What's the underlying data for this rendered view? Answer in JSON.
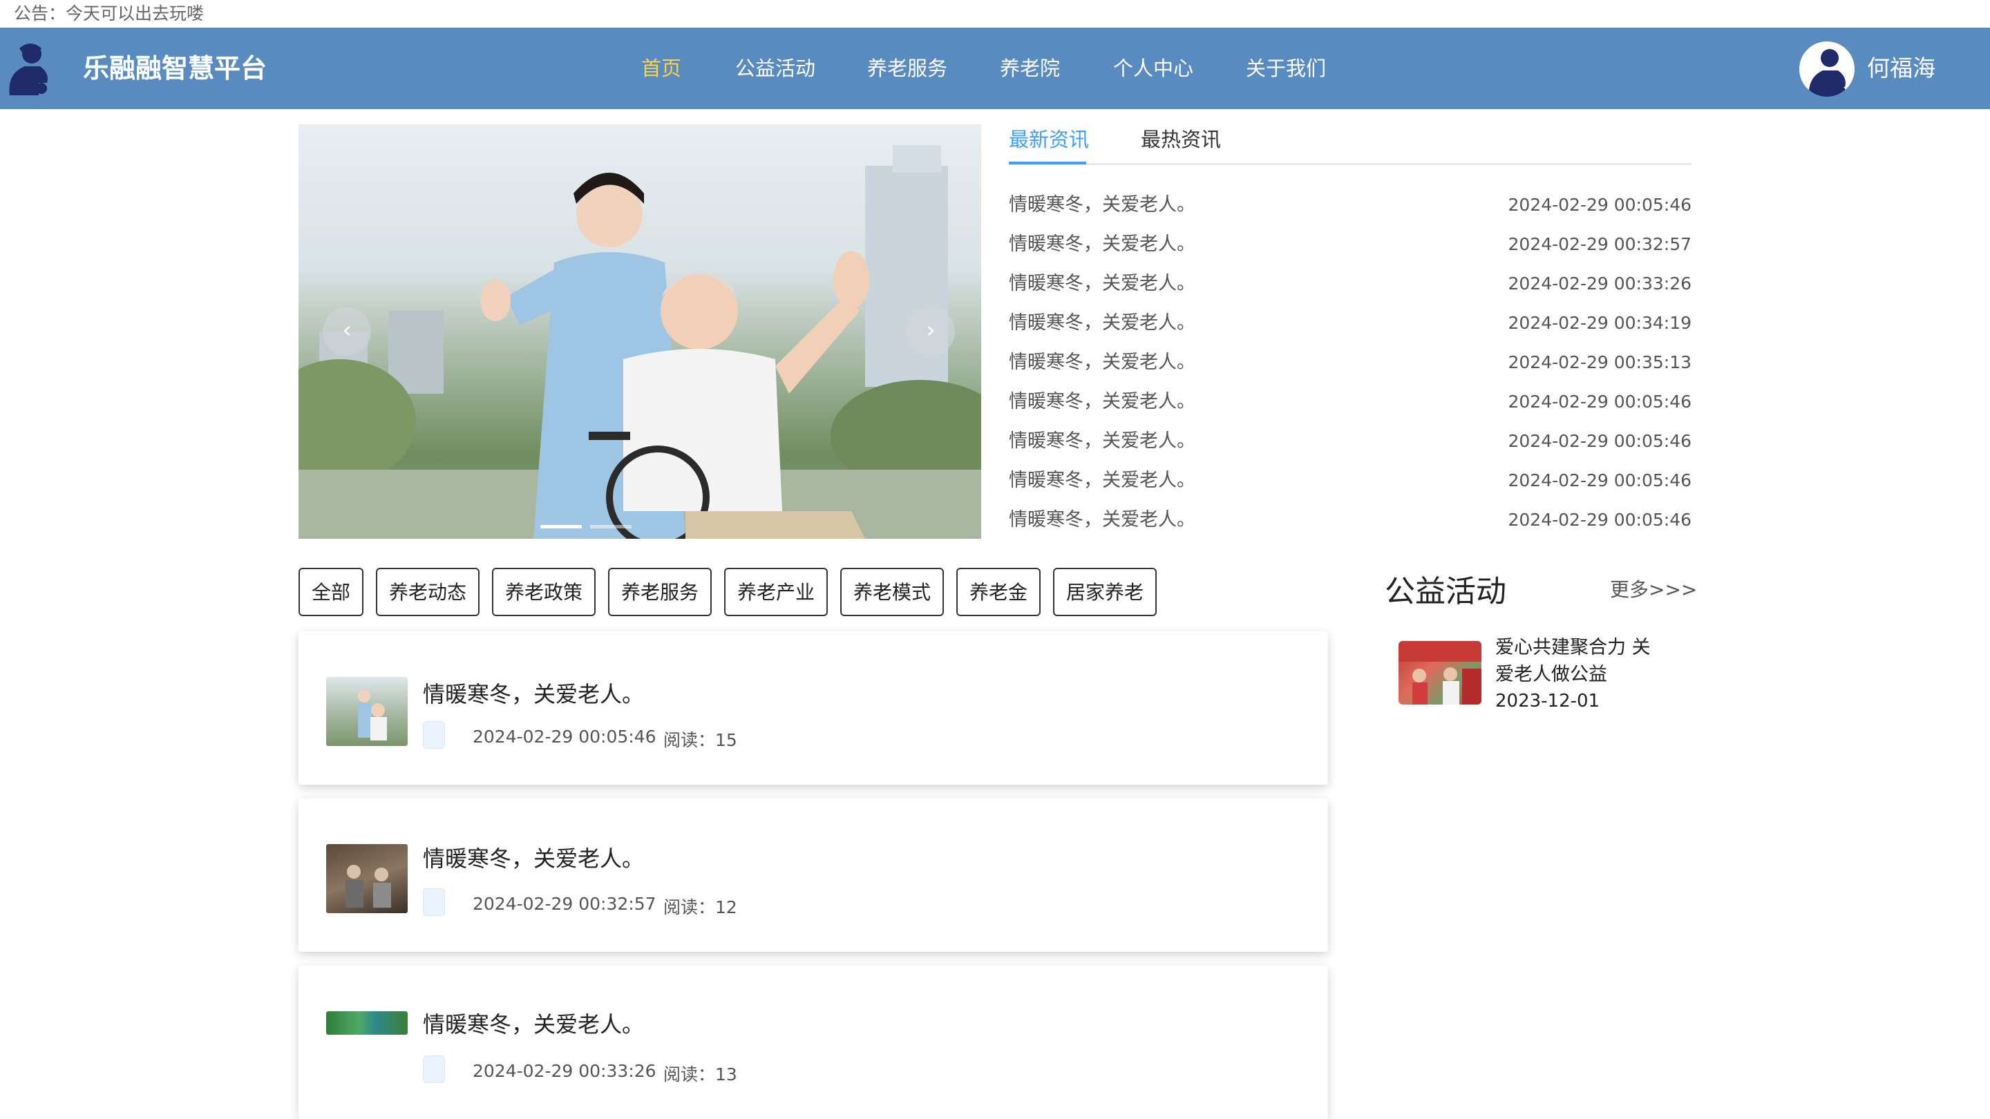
{
  "notice": "公告：今天可以出去玩喽",
  "header": {
    "brand": "乐融融智慧平台",
    "nav": [
      "首页",
      "公益活动",
      "养老服务",
      "养老院",
      "个人中心",
      "关于我们"
    ],
    "active_nav": "首页",
    "username": "何福海",
    "colors": {
      "bar": "#5a8bc0",
      "active": "#ffd24a"
    }
  },
  "carousel": {
    "prev_icon": "chevron-left-icon",
    "next_icon": "chevron-right-icon",
    "prev_glyph": "‹",
    "next_glyph": "›"
  },
  "news": {
    "tabs": [
      "最新资讯",
      "最热资讯"
    ],
    "items": [
      {
        "title": "情暖寒冬，关爱老人。",
        "time": "2024-02-29 00:05:46"
      },
      {
        "title": "情暖寒冬，关爱老人。",
        "time": "2024-02-29 00:32:57"
      },
      {
        "title": "情暖寒冬，关爱老人。",
        "time": "2024-02-29 00:33:26"
      },
      {
        "title": "情暖寒冬，关爱老人。",
        "time": "2024-02-29 00:34:19"
      },
      {
        "title": "情暖寒冬，关爱老人。",
        "time": "2024-02-29 00:35:13"
      },
      {
        "title": "情暖寒冬，关爱老人。",
        "time": "2024-02-29 00:05:46"
      },
      {
        "title": "情暖寒冬，关爱老人。",
        "time": "2024-02-29 00:05:46"
      },
      {
        "title": "情暖寒冬，关爱老人。",
        "time": "2024-02-29 00:05:46"
      },
      {
        "title": "情暖寒冬，关爱老人。",
        "time": "2024-02-29 00:05:46"
      }
    ]
  },
  "categories": [
    "全部",
    "养老动态",
    "养老政策",
    "养老服务",
    "养老产业",
    "养老模式",
    "养老金",
    "居家养老"
  ],
  "articles": [
    {
      "title": "情暖寒冬，关爱老人。",
      "date": "2024-02-29 00:05:46",
      "reads": "阅读：15"
    },
    {
      "title": "情暖寒冬，关爱老人。",
      "date": "2024-02-29 00:32:57",
      "reads": "阅读：12"
    },
    {
      "title": "情暖寒冬，关爱老人。",
      "date": "2024-02-29 00:33:26",
      "reads": "阅读：13"
    }
  ],
  "sidebar": {
    "title": "公益活动",
    "more": "更多>>>",
    "item": {
      "title": "爱心共建聚合力 关爱老人做公益",
      "date": "2023-12-01"
    }
  }
}
